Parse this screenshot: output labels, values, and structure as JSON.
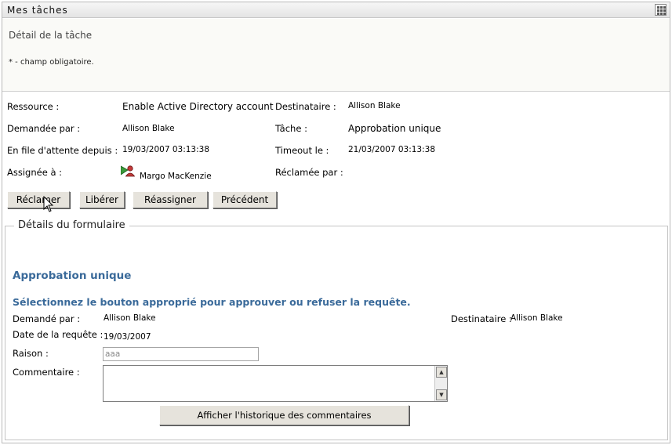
{
  "window": {
    "title": "Mes tâches"
  },
  "header": {
    "title": "Détail de la tâche",
    "required_note": "* - champ obligatoire."
  },
  "task": {
    "resource_label": "Ressource :",
    "resource_value": "Enable Active Directory account",
    "recipient_label": "Destinataire :",
    "recipient_value": "Allison Blake",
    "requested_by_label": "Demandée par :",
    "requested_by_value": "Allison Blake",
    "task_label": "Tâche :",
    "task_value": "Approbation unique",
    "queued_since_label": "En file d'attente depuis :",
    "queued_since_value": "19/03/2007 03:13:38",
    "timeout_label": "Timeout le :",
    "timeout_value": "21/03/2007 03:13:38",
    "assigned_to_label": "Assignée à :",
    "assigned_to_value": "Margo MacKenzie",
    "claimed_by_label": "Réclamée par :"
  },
  "actions": {
    "claim": "Réclamer",
    "release": "Libérer",
    "reassign": "Réassigner",
    "previous": "Précédent"
  },
  "form": {
    "legend": "Détails du formulaire",
    "title": "Approbation unique",
    "subtitle": "Sélectionnez le bouton approprié pour approuver ou refuser la requête.",
    "requested_by_label": "Demandé par :",
    "requested_by_value": "Allison Blake",
    "recipient_label": "Destinataire :",
    "recipient_value": "Allison Blake",
    "request_date_label": "Date de la requête :",
    "request_date_value": "19/03/2007",
    "reason_label": "Raison :",
    "reason_value": "aaa",
    "comment_label": "Commentaire :",
    "history_button": "Afficher l'historique des commentaires"
  },
  "colors": {
    "section_title": "#3a6a9a",
    "button_face": "#e6e3dc"
  }
}
